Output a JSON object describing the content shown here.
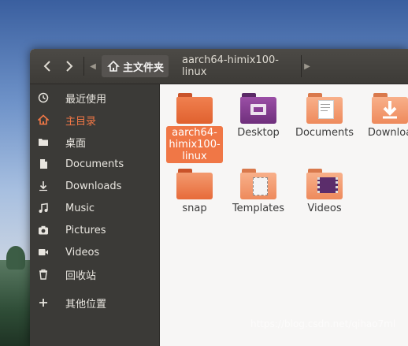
{
  "header": {
    "back_symbol": "‹",
    "forward_symbol": "›",
    "scroll_left": "◀",
    "scroll_right": "▶",
    "breadcrumb": [
      "主文件夹",
      "aarch64-himix100-linux"
    ]
  },
  "sidebar": {
    "items": [
      {
        "label": "最近使用",
        "icon": "clock-icon",
        "active": false
      },
      {
        "label": "主目录",
        "icon": "home-icon",
        "active": true
      },
      {
        "label": "桌面",
        "icon": "folder-icon",
        "active": false
      },
      {
        "label": "Documents",
        "icon": "document-icon",
        "active": false
      },
      {
        "label": "Downloads",
        "icon": "download-icon",
        "active": false
      },
      {
        "label": "Music",
        "icon": "music-icon",
        "active": false
      },
      {
        "label": "Pictures",
        "icon": "camera-icon",
        "active": false
      },
      {
        "label": "Videos",
        "icon": "video-icon",
        "active": false
      },
      {
        "label": "回收站",
        "icon": "trash-icon",
        "active": false
      },
      {
        "label": "其他位置",
        "icon": "plus-icon",
        "active": false
      }
    ]
  },
  "files": [
    {
      "name": "aarch64-\nhimix100-\nlinux",
      "icon": "folder-icon",
      "selected": true
    },
    {
      "name": "Desktop",
      "icon": "desktop-folder-icon",
      "selected": false
    },
    {
      "name": "Documents",
      "icon": "documents-folder-icon",
      "selected": false
    },
    {
      "name": "Downloa",
      "icon": "downloads-folder-icon",
      "selected": false
    },
    {
      "name": "snap",
      "icon": "folder-icon",
      "selected": false
    },
    {
      "name": "Templates",
      "icon": "templates-folder-icon",
      "selected": false
    },
    {
      "name": "Videos",
      "icon": "videos-folder-icon",
      "selected": false
    }
  ],
  "watermark": "https://blog.csdn.net/qihao7ml",
  "colors": {
    "accent": "#f07746",
    "folder_orange": "#e8693a",
    "folder_light": "#f5a27a",
    "desktop_purple": "#7b3a87"
  }
}
